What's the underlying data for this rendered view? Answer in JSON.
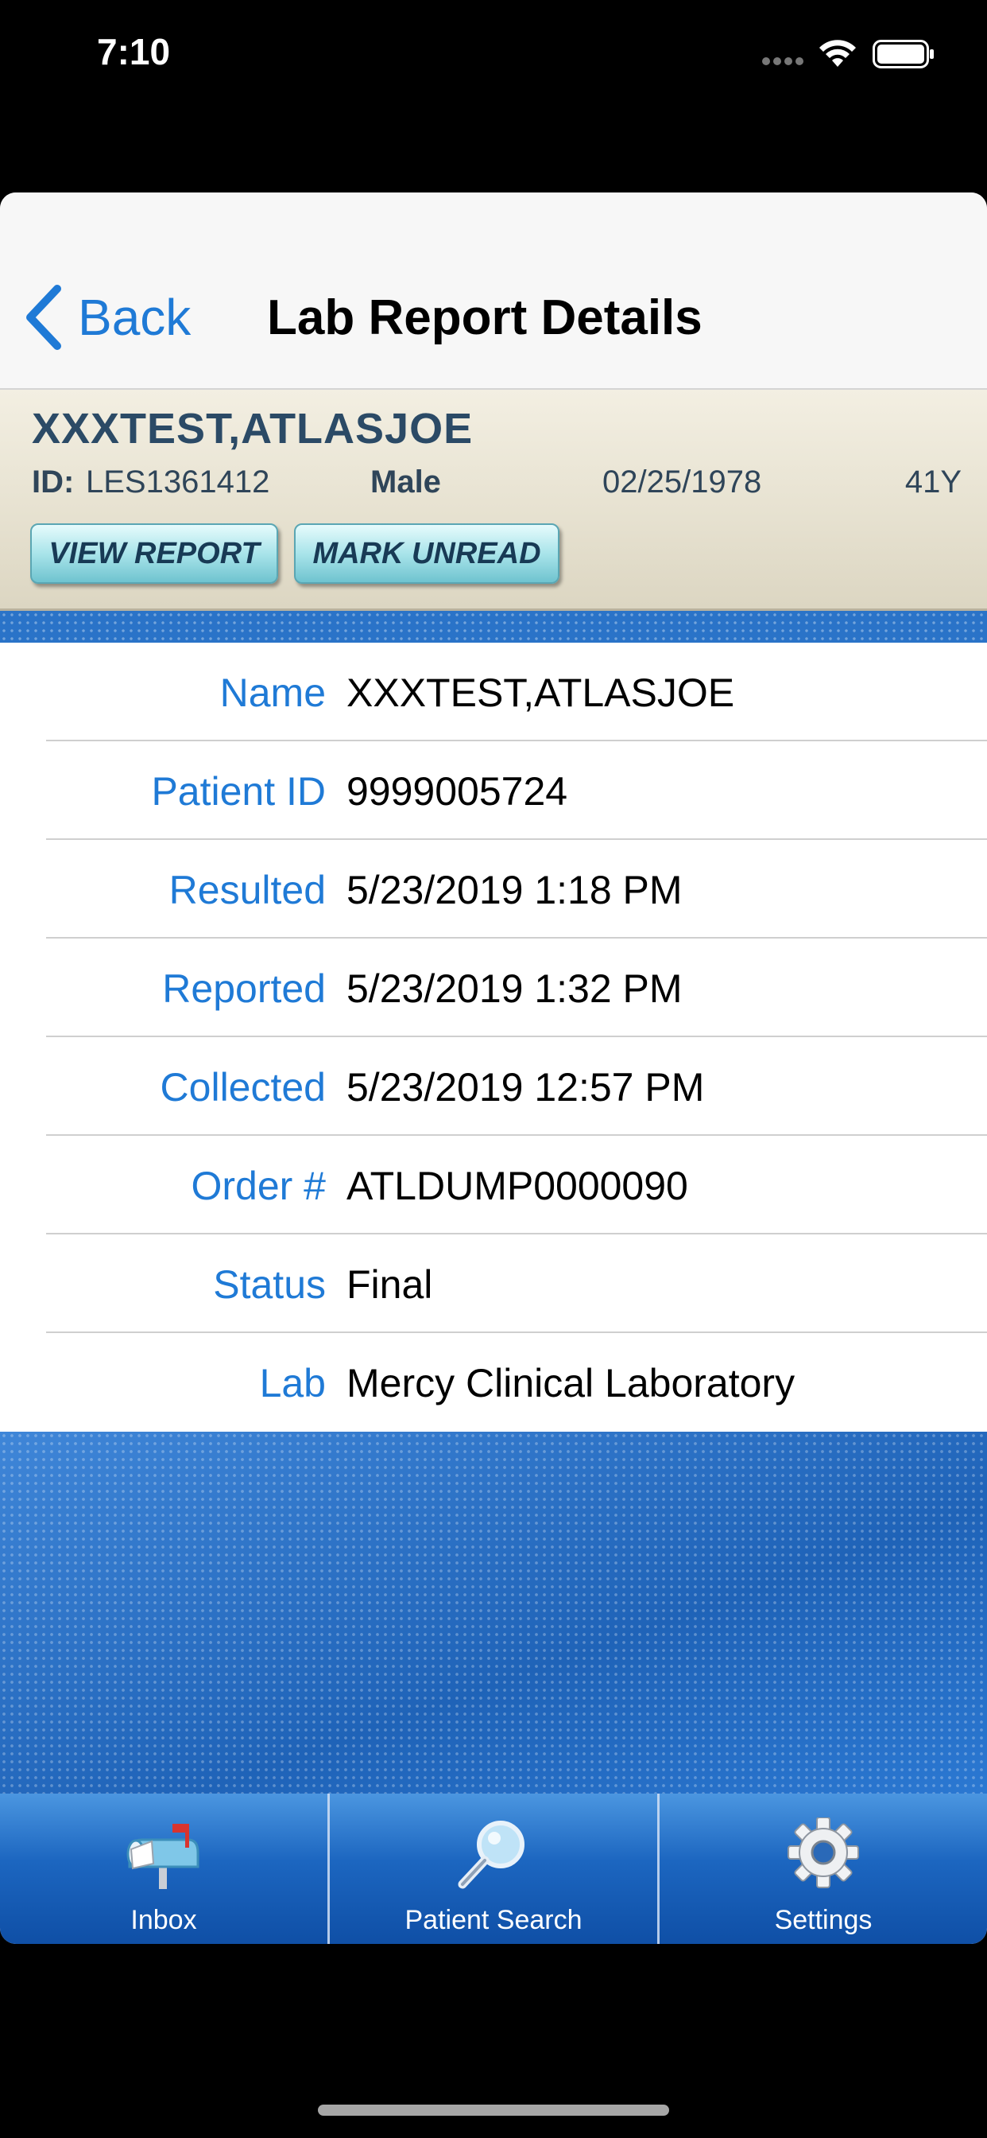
{
  "status_bar": {
    "time": "7:10"
  },
  "nav": {
    "back_label": "Back",
    "title": "Lab Report Details"
  },
  "patient": {
    "name": "XXXTEST,ATLASJOE",
    "id_label": "ID:",
    "id_value": "LES1361412",
    "gender": "Male",
    "dob": "02/25/1978",
    "age": "41Y"
  },
  "actions": {
    "view_report": "VIEW REPORT",
    "mark_unread": "MARK UNREAD"
  },
  "details": [
    {
      "label": "Name",
      "value": "XXXTEST,ATLASJOE"
    },
    {
      "label": "Patient ID",
      "value": "9999005724"
    },
    {
      "label": "Resulted",
      "value": "5/23/2019 1:18 PM"
    },
    {
      "label": "Reported",
      "value": "5/23/2019 1:32 PM"
    },
    {
      "label": "Collected",
      "value": "5/23/2019 12:57 PM"
    },
    {
      "label": "Order #",
      "value": "ATLDUMP0000090"
    },
    {
      "label": "Status",
      "value": "Final"
    },
    {
      "label": "Lab",
      "value": "Mercy Clinical Laboratory"
    }
  ],
  "tabs": [
    {
      "label": "Inbox",
      "icon": "mailbox-icon"
    },
    {
      "label": "Patient Search",
      "icon": "magnifier-icon"
    },
    {
      "label": "Settings",
      "icon": "gear-icon"
    }
  ],
  "colors": {
    "accent": "#1f7ad6",
    "header_text": "#2b4a66",
    "tab_bar": "#1c66c0"
  }
}
